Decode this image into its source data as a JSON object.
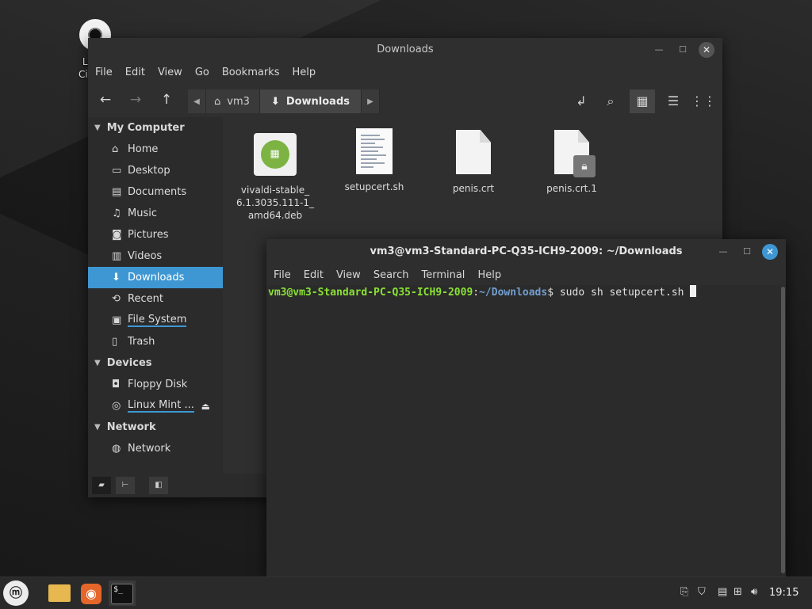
{
  "desktop": {
    "icon_label_line1": "Linux",
    "icon_label_line2": "Cinnan"
  },
  "file_manager": {
    "title": "Downloads",
    "menu": [
      "File",
      "Edit",
      "View",
      "Go",
      "Bookmarks",
      "Help"
    ],
    "path": {
      "parent": "vm3",
      "current": "Downloads"
    },
    "sidebar": {
      "sections": [
        {
          "header": "My Computer",
          "items": [
            {
              "label": "Home",
              "icon": "home-icon"
            },
            {
              "label": "Desktop",
              "icon": "desktop-icon"
            },
            {
              "label": "Documents",
              "icon": "documents-icon"
            },
            {
              "label": "Music",
              "icon": "music-icon"
            },
            {
              "label": "Pictures",
              "icon": "camera-icon"
            },
            {
              "label": "Videos",
              "icon": "film-icon"
            },
            {
              "label": "Downloads",
              "icon": "download-icon",
              "selected": true
            },
            {
              "label": "Recent",
              "icon": "recent-icon"
            },
            {
              "label": "File System",
              "icon": "drive-icon"
            },
            {
              "label": "Trash",
              "icon": "trash-icon"
            }
          ]
        },
        {
          "header": "Devices",
          "items": [
            {
              "label": "Floppy Disk",
              "icon": "floppy-icon"
            },
            {
              "label": "Linux Mint ...",
              "icon": "disc-icon"
            }
          ]
        },
        {
          "header": "Network",
          "items": [
            {
              "label": "Network",
              "icon": "network-icon"
            }
          ]
        }
      ]
    },
    "files": [
      {
        "name_lines": [
          "vivaldi-stable_",
          "6.1.3035.111-1_",
          "amd64.deb"
        ],
        "type": "deb"
      },
      {
        "name_lines": [
          "setupcert.sh"
        ],
        "type": "script"
      },
      {
        "name_lines": [
          "penis.crt"
        ],
        "type": "generic"
      },
      {
        "name_lines": [
          "penis.crt.1"
        ],
        "type": "locked"
      }
    ]
  },
  "terminal": {
    "title": "vm3@vm3-Standard-PC-Q35-ICH9-2009: ~/Downloads",
    "menu": [
      "File",
      "Edit",
      "View",
      "Search",
      "Terminal",
      "Help"
    ],
    "prompt_user": "vm3@vm3-Standard-PC-Q35-ICH9-2009",
    "prompt_sep": ":",
    "prompt_path": "~/Downloads",
    "prompt_end": "$ ",
    "command": "sudo sh setupcert.sh "
  },
  "panel": {
    "clock": "19:15",
    "menu_glyph": "ⓜ",
    "colors": {
      "accent": "#3e97d3",
      "prompt_user": "#8ae234",
      "prompt_path": "#729fcf"
    }
  }
}
